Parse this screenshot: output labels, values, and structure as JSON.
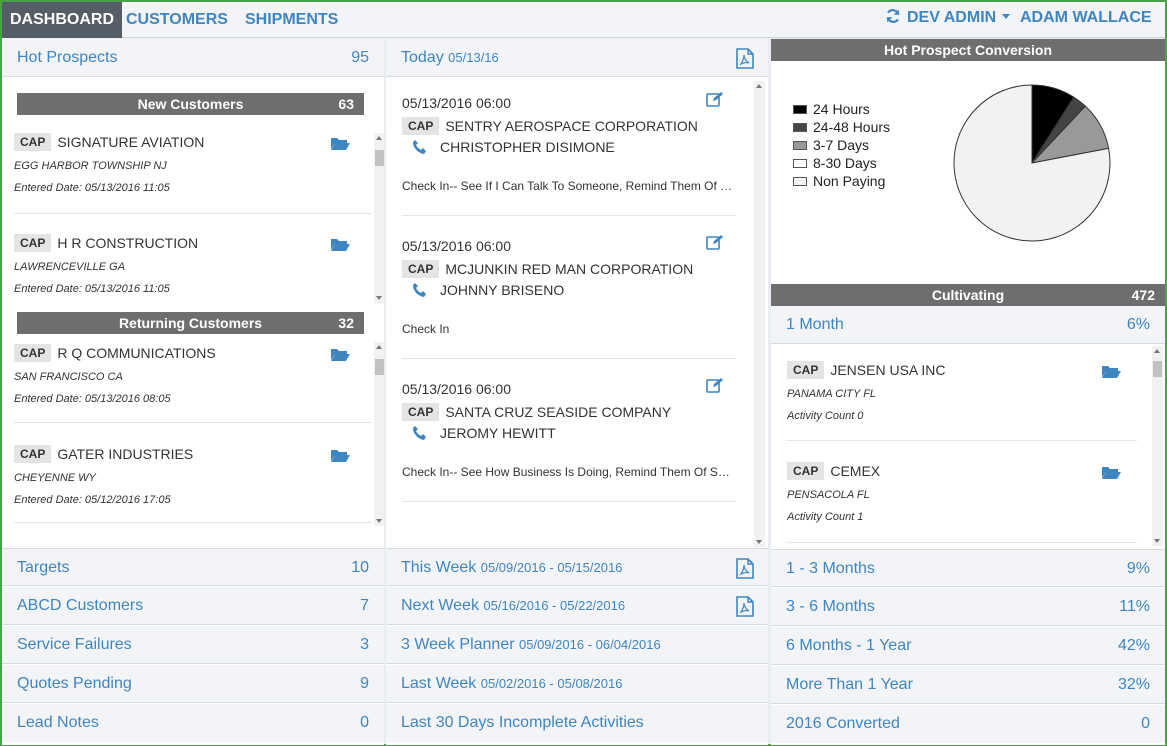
{
  "nav": {
    "tabs": [
      {
        "label": "DASHBOARD",
        "active": true
      },
      {
        "label": "CUSTOMERS",
        "active": false
      },
      {
        "label": "SHIPMENTS",
        "active": false
      }
    ],
    "dev_admin_label": "DEV ADMIN",
    "user_label": "ADAM WALLACE"
  },
  "left": {
    "hot_prospects": {
      "label": "Hot Prospects",
      "count": "95"
    },
    "new_customers": {
      "label": "New Customers",
      "count": "63",
      "items": [
        {
          "badge": "CAP",
          "name": "SIGNATURE AVIATION",
          "location": "EGG HARBOR TOWNSHIP NJ",
          "date": "Entered Date: 05/13/2016 11:05"
        },
        {
          "badge": "CAP",
          "name": "H R CONSTRUCTION",
          "location": "LAWRENCEVILLE GA",
          "date": "Entered Date: 05/13/2016 11:05"
        }
      ]
    },
    "returning_customers": {
      "label": "Returning Customers",
      "count": "32",
      "items": [
        {
          "badge": "CAP",
          "name": "R Q COMMUNICATIONS",
          "location": "SAN FRANCISCO CA",
          "date": "Entered Date: 05/13/2016 08:05"
        },
        {
          "badge": "CAP",
          "name": "GATER INDUSTRIES",
          "location": "CHEYENNE WY",
          "date": "Entered Date: 05/12/2016 17:05"
        }
      ]
    },
    "bottom": [
      {
        "label": "Targets",
        "count": "10"
      },
      {
        "label": "ABCD Customers",
        "count": "7"
      },
      {
        "label": "Service Failures",
        "count": "3"
      },
      {
        "label": "Quotes Pending",
        "count": "9"
      },
      {
        "label": "Lead Notes",
        "count": "0"
      }
    ]
  },
  "middle": {
    "today": {
      "label": "Today",
      "date": "05/13/16"
    },
    "activities": [
      {
        "datetime": "05/13/2016 06:00",
        "badge": "CAP",
        "company": "SENTRY AEROSPACE CORPORATION",
        "contact": "CHRISTOPHER DISIMONE",
        "note": "Check In-- See If I Can Talk To Someone, Remind Them Of Our Services"
      },
      {
        "datetime": "05/13/2016 06:00",
        "badge": "CAP",
        "company": "MCJUNKIN RED MAN CORPORATION",
        "contact": "JOHNNY BRISENO",
        "note": "Check In"
      },
      {
        "datetime": "05/13/2016 06:00",
        "badge": "CAP",
        "company": "SANTA CRUZ SEASIDE COMPANY",
        "contact": "JEROMY HEWITT",
        "note": "Check In-- See How Business Is Doing, Remind Them Of Services"
      }
    ],
    "bottom": [
      {
        "label": "This Week",
        "range": "05/09/2016 - 05/15/2016",
        "pdf": true
      },
      {
        "label": "Next Week",
        "range": "05/16/2016 - 05/22/2016",
        "pdf": true
      },
      {
        "label": "3 Week Planner",
        "range": "05/09/2016 - 06/04/2016",
        "pdf": false
      },
      {
        "label": "Last Week",
        "range": "05/02/2016 - 05/08/2016",
        "pdf": false
      },
      {
        "label": "Last 30 Days Incomplete Activities",
        "range": "",
        "pdf": false
      }
    ]
  },
  "right": {
    "conversion": {
      "title": "Hot Prospect Conversion",
      "legend": [
        {
          "label": "24 Hours",
          "color": "#000000"
        },
        {
          "label": "24-48 Hours",
          "color": "#444444"
        },
        {
          "label": "3-7 Days",
          "color": "#999999"
        },
        {
          "label": "8-30 Days",
          "color": "#ffffff"
        },
        {
          "label": "Non Paying",
          "color": "#f5f5f5"
        }
      ],
      "chart_data": {
        "type": "pie",
        "categories": [
          "24 Hours",
          "24-48 Hours",
          "3-7 Days",
          "8-30 Days",
          "Non Paying"
        ],
        "values": [
          9,
          3,
          10,
          0,
          78
        ],
        "colors": [
          "#000000",
          "#444444",
          "#999999",
          "#ffffff",
          "#f2f2f2"
        ]
      }
    },
    "cultivating": {
      "label": "Cultivating",
      "count": "472"
    },
    "one_month": {
      "label": "1 Month",
      "pct": "6%"
    },
    "items": [
      {
        "badge": "CAP",
        "name": "JENSEN USA INC",
        "location": "PANAMA CITY FL",
        "activity": "Activity Count 0"
      },
      {
        "badge": "CAP",
        "name": "CEMEX",
        "location": "PENSACOLA FL",
        "activity": "Activity Count 1"
      }
    ],
    "bottom": [
      {
        "label": "1 - 3 Months",
        "pct": "9%"
      },
      {
        "label": "3 - 6 Months",
        "pct": "11%"
      },
      {
        "label": "6 Months - 1 Year",
        "pct": "42%"
      },
      {
        "label": "More Than 1 Year",
        "pct": "32%"
      },
      {
        "label": "2016 Converted",
        "pct": "0"
      }
    ]
  },
  "colors": {
    "accent": "#3f86c0",
    "dark_bar": "#6e6e6e",
    "nav_active": "#555d66"
  }
}
